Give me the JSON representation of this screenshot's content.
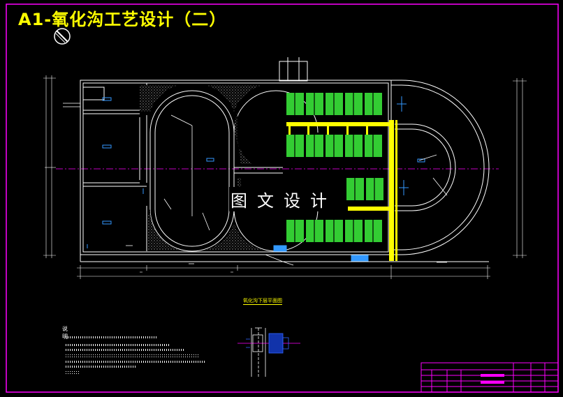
{
  "title": "A1-氧化沟工艺设计（二）",
  "watermark": "图文设计",
  "plan_caption": "氧化沟下层平面图",
  "notes": {
    "heading": "说",
    "mark": "明"
  },
  "colors": {
    "frame": "#ff00ff",
    "structure": "#ffffff",
    "aerator": "#33cc33",
    "pipe": "#ffff00",
    "fill_hatch": "#ffffff",
    "centerline": "#ff00ff",
    "equipment": "#00aaff"
  },
  "icons": {
    "north_arrow": "north-arrow-icon"
  }
}
